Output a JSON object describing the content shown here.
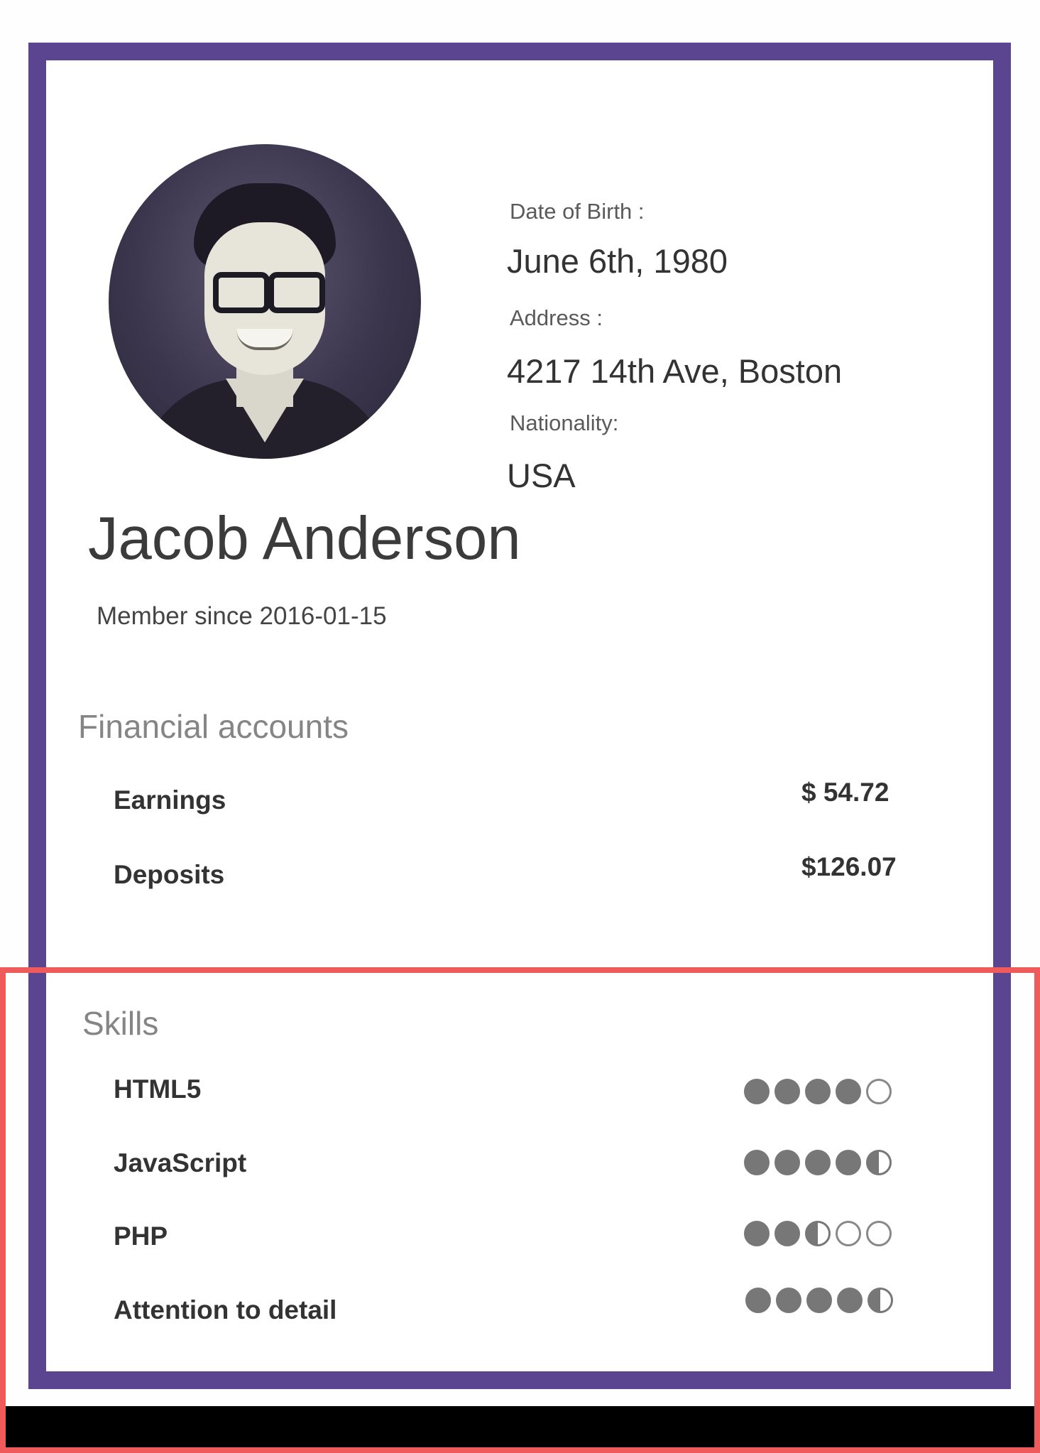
{
  "profile": {
    "name": "Jacob Anderson",
    "member_since": "Member since 2016-01-15",
    "dob_label": "Date of Birth :",
    "dob_value": "June 6th, 1980",
    "address_label": "Address :",
    "address_value": "4217 14th Ave, Boston",
    "nationality_label": "Nationality:",
    "nationality_value": "USA"
  },
  "financial": {
    "title": "Financial accounts",
    "rows": [
      {
        "label": "Earnings",
        "value": "$ 54.72"
      },
      {
        "label": "Deposits",
        "value": "$126.07"
      }
    ]
  },
  "skills": {
    "title": "Skills",
    "max_rating": 5,
    "rows": [
      {
        "label": "HTML5",
        "rating": 4
      },
      {
        "label": "JavaScript",
        "rating": 4.5
      },
      {
        "label": "PHP",
        "rating": 2.5
      },
      {
        "label": "Attention to detail",
        "rating": 4.5
      }
    ]
  },
  "colors": {
    "card_border": "#5b4590",
    "highlight": "#ef5a5a",
    "rating_fill": "#777777"
  },
  "icons": {
    "avatar": "profile-photo",
    "rating_full": "filled-circle",
    "rating_half": "half-filled-circle",
    "rating_empty": "empty-circle"
  }
}
